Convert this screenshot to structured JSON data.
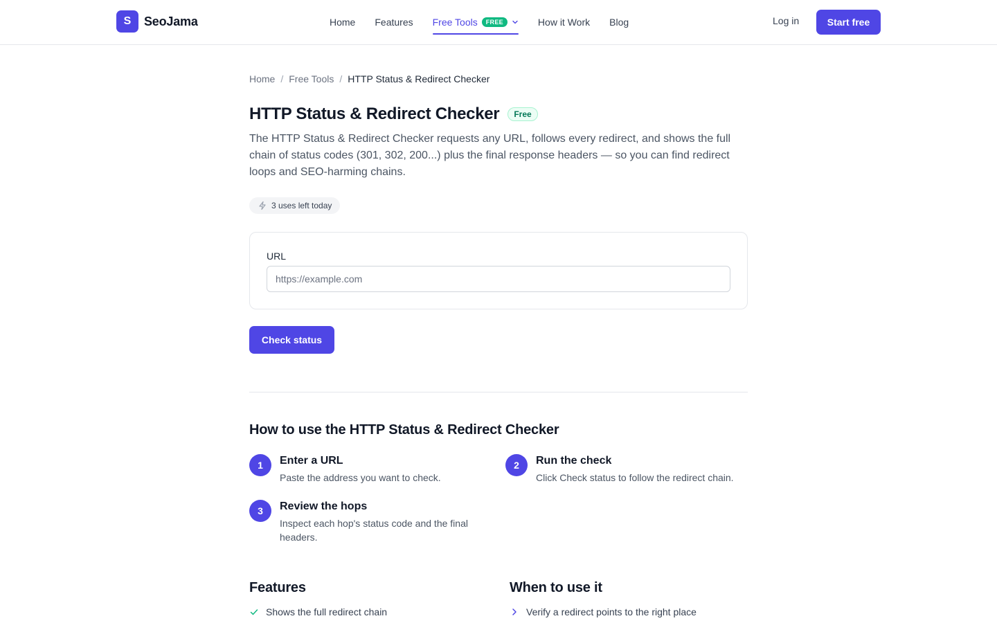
{
  "brand": {
    "mark": "S",
    "name": "SeoJama"
  },
  "nav": {
    "items": [
      {
        "label": "Home"
      },
      {
        "label": "Features"
      },
      {
        "label": "Free Tools",
        "badge": "FREE",
        "active": true
      },
      {
        "label": "How it Work"
      },
      {
        "label": "Blog"
      }
    ],
    "login": "Log in",
    "cta": "Start free"
  },
  "breadcrumb": [
    "Home",
    "Free Tools",
    "HTTP Status & Redirect Checker"
  ],
  "page": {
    "title": "HTTP Status & Redirect Checker",
    "badge": "Free",
    "description": "The HTTP Status & Redirect Checker requests any URL, follows every redirect, and shows the full chain of status codes (301, 302, 200...) plus the final response headers — so you can find redirect loops and SEO-harming chains.",
    "uses_left": "3 uses left today"
  },
  "form": {
    "label": "URL",
    "placeholder": "https://example.com",
    "value": "",
    "submit": "Check status"
  },
  "howto": {
    "title": "How to use the HTTP Status & Redirect Checker",
    "steps": [
      {
        "num": "1",
        "title": "Enter a URL",
        "desc": "Paste the address you want to check."
      },
      {
        "num": "2",
        "title": "Run the check",
        "desc": "Click Check status to follow the redirect chain."
      },
      {
        "num": "3",
        "title": "Review the hops",
        "desc": "Inspect each hop's status code and the final headers."
      }
    ]
  },
  "features": {
    "title": "Features",
    "items": [
      "Shows the full redirect chain"
    ]
  },
  "when": {
    "title": "When to use it",
    "items": [
      "Verify a redirect points to the right place"
    ]
  },
  "colors": {
    "accent": "#4f46e5",
    "success": "#10b981"
  },
  "icons": [
    "chevron-down-icon",
    "lightning-icon",
    "check-icon",
    "chevron-right-icon"
  ]
}
